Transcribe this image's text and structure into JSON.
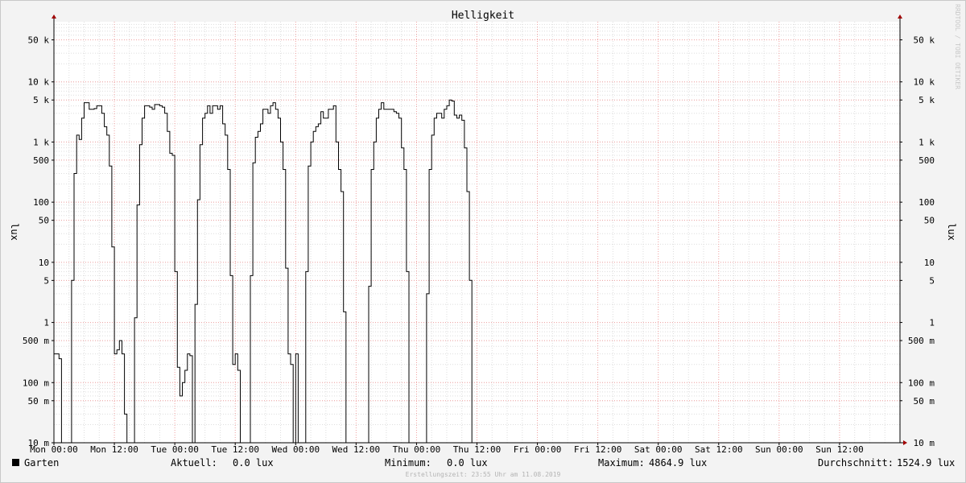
{
  "chart_data": {
    "type": "line",
    "title": "Helligkeit",
    "ylabel": "lux",
    "yscale": "log",
    "ylim": [
      0.01,
      100000
    ],
    "xlim_hours": [
      0,
      168
    ],
    "vendor_text": "RRDTOOL / TOBI OETIKER",
    "x_ticks": [
      {
        "label": "Mon 00:00",
        "hour": 0
      },
      {
        "label": "Mon 12:00",
        "hour": 12
      },
      {
        "label": "Tue 00:00",
        "hour": 24
      },
      {
        "label": "Tue 12:00",
        "hour": 36
      },
      {
        "label": "Wed 00:00",
        "hour": 48
      },
      {
        "label": "Wed 12:00",
        "hour": 60
      },
      {
        "label": "Thu 00:00",
        "hour": 72
      },
      {
        "label": "Thu 12:00",
        "hour": 84
      },
      {
        "label": "Fri 00:00",
        "hour": 96
      },
      {
        "label": "Fri 12:00",
        "hour": 108
      },
      {
        "label": "Sat 00:00",
        "hour": 120
      },
      {
        "label": "Sat 12:00",
        "hour": 132
      },
      {
        "label": "Sun 00:00",
        "hour": 144
      },
      {
        "label": "Sun 12:00",
        "hour": 156
      }
    ],
    "y_ticks": [
      {
        "label": "10 m",
        "value": 0.01
      },
      {
        "label": "50 m",
        "value": 0.05
      },
      {
        "label": "100 m",
        "value": 0.1
      },
      {
        "label": "500 m",
        "value": 0.5
      },
      {
        "label": "1",
        "value": 1
      },
      {
        "label": "5",
        "value": 5
      },
      {
        "label": "10",
        "value": 10
      },
      {
        "label": "50",
        "value": 50
      },
      {
        "label": "100",
        "value": 100
      },
      {
        "label": "500",
        "value": 500
      },
      {
        "label": "1 k",
        "value": 1000
      },
      {
        "label": "5 k",
        "value": 5000
      },
      {
        "label": "10 k",
        "value": 10000
      },
      {
        "label": "50 k",
        "value": 50000
      }
    ],
    "series": [
      {
        "name": "Garten",
        "color": "#000000",
        "hours": [
          0,
          0.5,
          1,
          1.5,
          2,
          2.5,
          3,
          3.5,
          4,
          4.5,
          5,
          5.5,
          6,
          6.5,
          7,
          7.5,
          8,
          8.5,
          9,
          9.5,
          10,
          10.5,
          11,
          11.5,
          12,
          12.5,
          13,
          13.5,
          14,
          14.5,
          15,
          15.5,
          16,
          16.5,
          17,
          17.5,
          18,
          18.5,
          19,
          19.5,
          20,
          20.5,
          21,
          21.5,
          22,
          22.5,
          23,
          23.5,
          24,
          24.5,
          25,
          25.5,
          26,
          26.5,
          27,
          27.5,
          28,
          28.5,
          29,
          29.5,
          30,
          30.5,
          31,
          31.5,
          32,
          32.5,
          33,
          33.5,
          34,
          34.5,
          35,
          35.5,
          36,
          36.5,
          37,
          37.5,
          38,
          38.5,
          39,
          39.5,
          40,
          40.5,
          41,
          41.5,
          42,
          42.5,
          43,
          43.5,
          44,
          44.5,
          45,
          45.5,
          46,
          46.5,
          47,
          47.5,
          48,
          48.5,
          49,
          49.5,
          50,
          50.5,
          51,
          51.5,
          52,
          52.5,
          53,
          53.5,
          54,
          54.5,
          55,
          55.5,
          56,
          56.5,
          57,
          57.5,
          58,
          58.5,
          59,
          59.5,
          60,
          60.5,
          61,
          61.5,
          62,
          62.5,
          63,
          63.5,
          64,
          64.5,
          65,
          65.5,
          66,
          66.5,
          67,
          67.5,
          68,
          68.5,
          69,
          69.5,
          70,
          70.5,
          71,
          71.5,
          72,
          72.5,
          73,
          73.5,
          74,
          74.5,
          75,
          75.5,
          76,
          76.5,
          77,
          77.5,
          78,
          78.5,
          79,
          79.5,
          80,
          80.5,
          81,
          81.5,
          82,
          82.5,
          83,
          83.5,
          84,
          84.5,
          85,
          85.5,
          86,
          86.5,
          87,
          87.5,
          88,
          88.5,
          89,
          89.5,
          90,
          90.5,
          91,
          91.5,
          92,
          92.5,
          93,
          93.5,
          94,
          94.5,
          95,
          95.5,
          96,
          96.5,
          97,
          97.5,
          98,
          98.5,
          99,
          99.5,
          100,
          100.5,
          101,
          101.5,
          102,
          102.5,
          103,
          103.5,
          104,
          104.5,
          105,
          105.5,
          106,
          106.5,
          107,
          107.5,
          108,
          108.5,
          109,
          109.5,
          110,
          110.5,
          111,
          111.5,
          112,
          112.5,
          113,
          113.5,
          114,
          114.5,
          115,
          115.5,
          116,
          116.5,
          117,
          117.5,
          118,
          118.5,
          119,
          119.5,
          120,
          120.5,
          121,
          121.5,
          122,
          122.5,
          123,
          123.5,
          124,
          124.5,
          125,
          125.5,
          126,
          126.5,
          127,
          127.5,
          128,
          128.5,
          129,
          129.5,
          130,
          130.5,
          131,
          131.5,
          132,
          132.5,
          133,
          133.5,
          134,
          134.5,
          135,
          135.5,
          136,
          136.5,
          137,
          137.5,
          138,
          138.5,
          139,
          139.5,
          140,
          140.5,
          141,
          141.5,
          142,
          142.5,
          143,
          143.5,
          144,
          144.5,
          145,
          145.5,
          146,
          146.5,
          147,
          147.5,
          148,
          148.5,
          149,
          149.5,
          150,
          150.5,
          151,
          151.5,
          152,
          152.5,
          153,
          153.5,
          154,
          154.5,
          155,
          155.5,
          156,
          156.5,
          157,
          157.5,
          158,
          158.5,
          159,
          159.5,
          160,
          160.5,
          161,
          161.5,
          162,
          162.5,
          163,
          163.5,
          164,
          164.5,
          165,
          165.5,
          166,
          166.5,
          167,
          167.5
        ],
        "values": [
          0.3,
          0.3,
          0.25,
          0.01,
          0.01,
          0.01,
          0.01,
          5,
          300,
          1300,
          1100,
          2500,
          4500,
          4500,
          3500,
          3500,
          3600,
          4000,
          4000,
          3000,
          1800,
          1300,
          400,
          18,
          0.3,
          0.35,
          0.5,
          0.3,
          0.03,
          0.01,
          0.01,
          0.01,
          1.2,
          90,
          900,
          2500,
          4000,
          4000,
          3800,
          3500,
          4200,
          4200,
          4000,
          3800,
          3000,
          1500,
          650,
          600,
          7,
          0.18,
          0.06,
          0.1,
          0.16,
          0.3,
          0.28,
          0.01,
          2,
          110,
          900,
          2500,
          3000,
          4000,
          3000,
          4000,
          4000,
          3500,
          4000,
          2000,
          1300,
          350,
          6,
          0.2,
          0.3,
          0.16,
          0.01,
          0.01,
          0.01,
          0.01,
          6,
          450,
          1200,
          1500,
          2000,
          3500,
          3500,
          3000,
          4000,
          4500,
          3500,
          2500,
          1000,
          350,
          8,
          0.3,
          0.2,
          0.01,
          0.3,
          0.01,
          0.01,
          0.01,
          7,
          400,
          1000,
          1500,
          1800,
          2000,
          3200,
          2500,
          2500,
          3500,
          3500,
          4000,
          1000,
          350,
          150,
          1.5,
          0.01,
          0.01,
          0.01,
          0.01,
          0.01,
          0.01,
          0.01,
          0.01,
          0.01,
          4,
          350,
          1000,
          2500,
          3500,
          4500,
          3500,
          3500,
          3500,
          3500,
          3200,
          3000,
          2500,
          800,
          350,
          7,
          0.01,
          0.01,
          0.01,
          0.01,
          0.01,
          0.01,
          0.01,
          3,
          350,
          1300,
          2500,
          3000,
          3000,
          2500,
          3500,
          4000,
          5000,
          4800,
          2800,
          2500,
          2800,
          2300,
          800,
          150,
          5,
          0.01
        ]
      }
    ]
  },
  "legend": {
    "series_name": "Garten",
    "swatch_color": "#000000",
    "stats": [
      {
        "label": "Aktuell:",
        "value": "0.0 lux"
      },
      {
        "label": "Minimum:",
        "value": "0.0 lux"
      },
      {
        "label": "Maximum:",
        "value": "4864.9 lux"
      },
      {
        "label": "Durchschnitt:",
        "value": "1524.9 lux"
      }
    ]
  },
  "footer": "Erstellungszeit: 23:55 Uhr am 11.08.2019",
  "colors": {
    "background": "#f3f3f3",
    "plot_background": "#ffffff",
    "major_grid": "#f0a0a0",
    "minor_grid": "#dddddd",
    "axis": "#000000",
    "arrow": "#a00000"
  }
}
